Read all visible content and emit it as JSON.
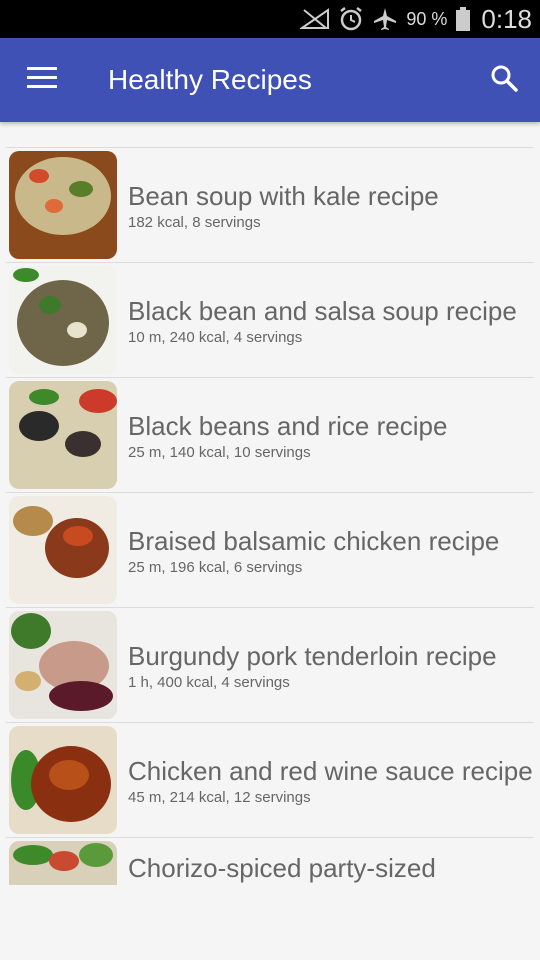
{
  "status_bar": {
    "battery": "90 %",
    "time": "0:18",
    "icons": [
      "no-signal-icon",
      "alarm-icon",
      "airplane-icon",
      "battery-icon"
    ]
  },
  "app_bar": {
    "title": "Healthy Recipes",
    "menu_icon": "menu-icon",
    "search_icon": "search-icon",
    "color": "#3f51b5"
  },
  "recipes": [
    {
      "title": "Bean soup with kale recipe",
      "meta": "182 kcal, 8 servings"
    },
    {
      "title": "Black bean and salsa soup recipe",
      "meta": "10 m, 240 kcal, 4 servings"
    },
    {
      "title": "Black beans and rice recipe",
      "meta": "25 m, 140 kcal, 10 servings"
    },
    {
      "title": "Braised balsamic chicken recipe",
      "meta": "25 m, 196 kcal, 6 servings"
    },
    {
      "title": "Burgundy pork tenderloin recipe",
      "meta": "1 h, 400 kcal, 4 servings"
    },
    {
      "title": "Chicken and red wine sauce recipe",
      "meta": "45 m, 214 kcal, 12 servings"
    },
    {
      "title": "Chorizo-spiced party-sized",
      "meta": ""
    }
  ]
}
